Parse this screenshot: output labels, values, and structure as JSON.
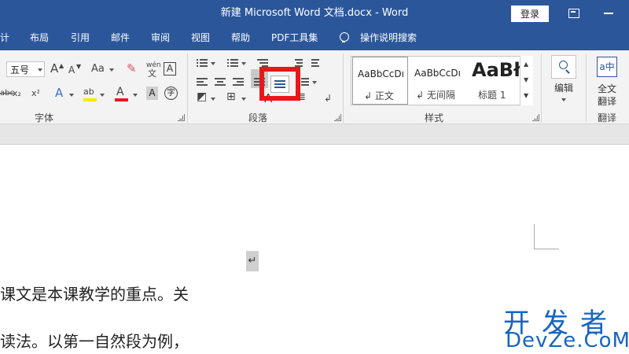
{
  "window": {
    "title": "新建 Microsoft Word 文档.docx  -  Word",
    "login_label": "登录"
  },
  "tabs": [
    {
      "label": "计"
    },
    {
      "label": "布局"
    },
    {
      "label": "引用"
    },
    {
      "label": "邮件"
    },
    {
      "label": "审阅"
    },
    {
      "label": "视图"
    },
    {
      "label": "帮助"
    },
    {
      "label": "PDF工具集"
    }
  ],
  "tell_me": {
    "label": "操作说明搜索",
    "icon": "lightbulb-icon"
  },
  "font_group": {
    "font_size": "五号",
    "label": "字体",
    "grow_font": "A",
    "shrink_font": "A",
    "change_case": "Aa",
    "phonetic_top": "wén",
    "phonetic_bottom": "文",
    "border_char": "A",
    "strike": "abc",
    "subscript": "x₂",
    "superscript": "x²",
    "text_effects": "A",
    "highlight": "ab",
    "font_color": "A",
    "char_shading": "A",
    "enclose_char": "字",
    "highlight_color": "#f5e900",
    "font_color_value": "#e8171c"
  },
  "paragraph_group": {
    "label": "段落",
    "text_direction": "A"
  },
  "styles_group": {
    "label": "样式",
    "items": [
      {
        "sample": "AaBbCcDı",
        "name": "↲ 正文"
      },
      {
        "sample": "AaBbCcDı",
        "name": "↲ 无间隔"
      },
      {
        "sample": "AaBł",
        "name": "标题 1"
      }
    ]
  },
  "editing_group": {
    "label": "编辑",
    "icon": "search-icon"
  },
  "translate_group": {
    "button_label_1": "全文",
    "button_label_2": "翻译",
    "label": "翻译",
    "icon_text": "a中"
  },
  "highlight": {
    "color": "#e8171c"
  },
  "document": {
    "paragraph_mark": "↵",
    "lines": [
      "课文是本课教学的重点。关",
      "读法。以第一自然段为例，"
    ]
  },
  "watermark": {
    "cn": "开发者",
    "en": "DevZe.CoM",
    "color": "#1565c0"
  }
}
